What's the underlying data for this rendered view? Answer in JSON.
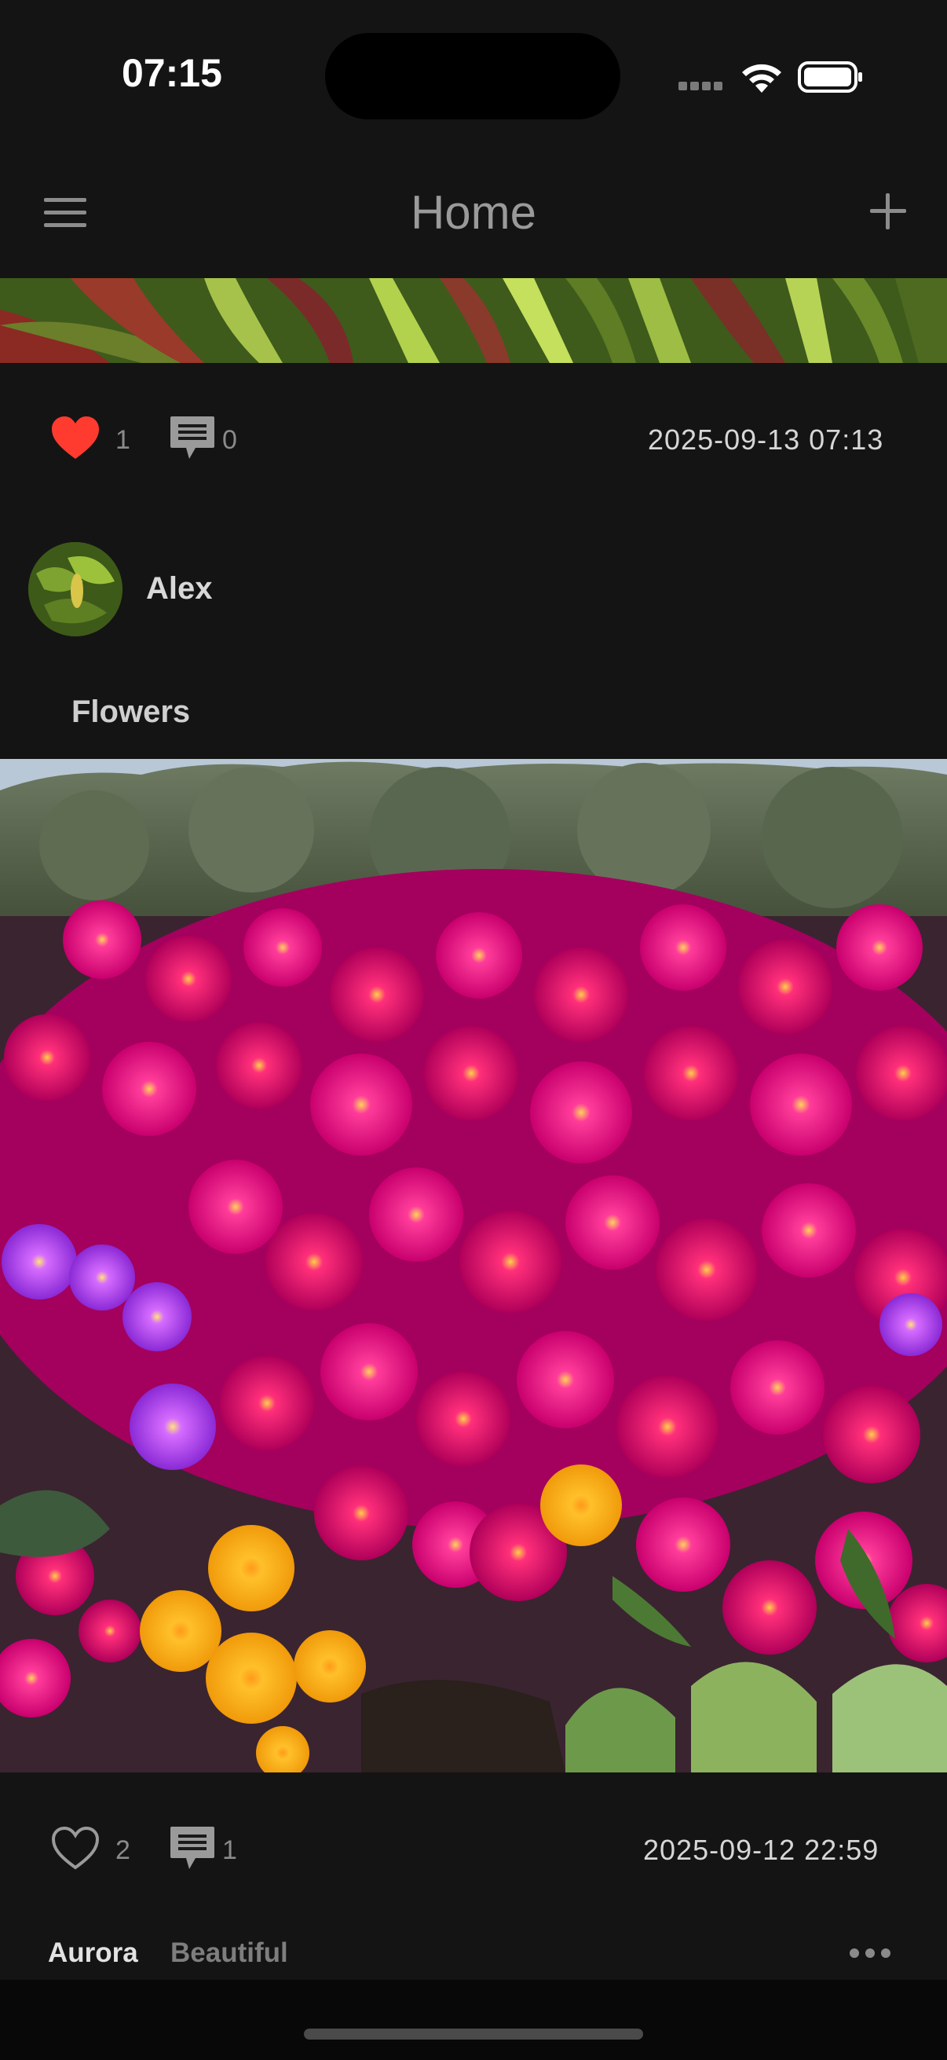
{
  "status_bar": {
    "time": "07:15",
    "icons": [
      "cellular-signal-icon",
      "wifi-icon",
      "battery-icon"
    ]
  },
  "nav": {
    "title": "Home",
    "left_icon": "hamburger-menu-icon",
    "right_icon": "plus-icon"
  },
  "posts": [
    {
      "image": "leaves-photo",
      "likes": "1",
      "liked": true,
      "comments": "0",
      "timestamp": "2025-09-13 07:13"
    },
    {
      "author": "Alex",
      "title": "Flowers",
      "image": "flowers-photo",
      "likes": "2",
      "liked": false,
      "comments": "1",
      "timestamp": "2025-09-12 22:59",
      "latest_comment": {
        "author": "Aurora",
        "text": "Beautiful"
      }
    }
  ],
  "colors": {
    "background": "#141414",
    "liked_heart": "#ff3b30",
    "muted_text": "#8a8a8a"
  }
}
